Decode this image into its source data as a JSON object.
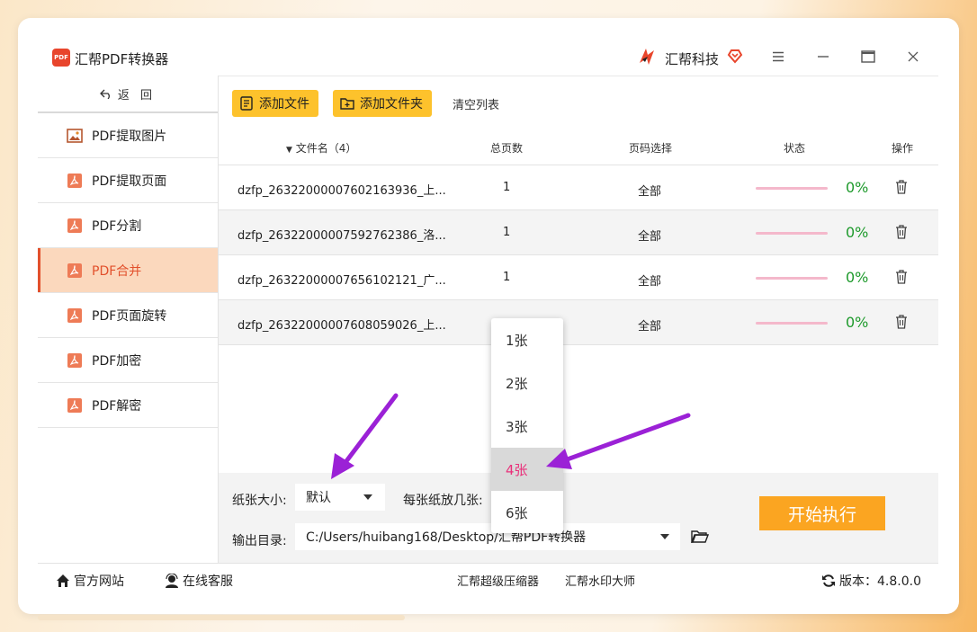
{
  "app": {
    "title": "汇帮PDF转换器",
    "logo_text": "PDF",
    "brand": "汇帮科技",
    "brand_color": "#e8452c",
    "accent": "#fdc22c"
  },
  "sidebar": {
    "back_label": "返 回",
    "items": [
      {
        "label": "PDF提取图片",
        "icon": "image-icon",
        "active": false
      },
      {
        "label": "PDF提取页面",
        "icon": "pdf-icon",
        "active": false
      },
      {
        "label": "PDF分割",
        "icon": "pdf-icon",
        "active": false
      },
      {
        "label": "PDF合并",
        "icon": "pdf-icon",
        "active": true
      },
      {
        "label": "PDF页面旋转",
        "icon": "pdf-icon",
        "active": false
      },
      {
        "label": "PDF加密",
        "icon": "pdf-icon",
        "active": false
      },
      {
        "label": "PDF解密",
        "icon": "pdf-icon",
        "active": false
      }
    ]
  },
  "toolbar": {
    "add_file": "添加文件",
    "add_folder": "添加文件夹",
    "clear_list": "清空列表"
  },
  "table": {
    "headers": {
      "filename": "文件名（4）",
      "pages": "总页数",
      "page_select": "页码选择",
      "status": "状态",
      "action": "操作"
    },
    "rows": [
      {
        "name": "dzfp_26322000007602163936_上...",
        "pages": "1",
        "range": "全部",
        "progress": 0,
        "progress_label": "0%"
      },
      {
        "name": "dzfp_26322000007592762386_洛...",
        "pages": "1",
        "range": "全部",
        "progress": 0,
        "progress_label": "0%"
      },
      {
        "name": "dzfp_26322000007656102121_广...",
        "pages": "1",
        "range": "全部",
        "progress": 0,
        "progress_label": "0%"
      },
      {
        "name": "dzfp_26322000007608059026_上...",
        "pages": "",
        "range": "全部",
        "progress": 0,
        "progress_label": "0%"
      }
    ]
  },
  "options": {
    "paper_label": "纸张大小:",
    "paper_value": "默认",
    "per_sheet_label": "每张纸放几张:",
    "output_label": "输出目录:",
    "output_value": "C:/Users/huibang168/Desktop/汇帮PDF转换器",
    "start_button": "开始执行"
  },
  "dropdown": {
    "options": [
      "1张",
      "2张",
      "3张",
      "4张",
      "6张"
    ],
    "selected": "4张"
  },
  "footer": {
    "website": "官方网站",
    "support": "在线客服",
    "compressor": "汇帮超级压缩器",
    "watermark": "汇帮水印大师",
    "version": "版本：4.8.0.0"
  },
  "annotation": {
    "arrow_color": "#9b21d6"
  }
}
